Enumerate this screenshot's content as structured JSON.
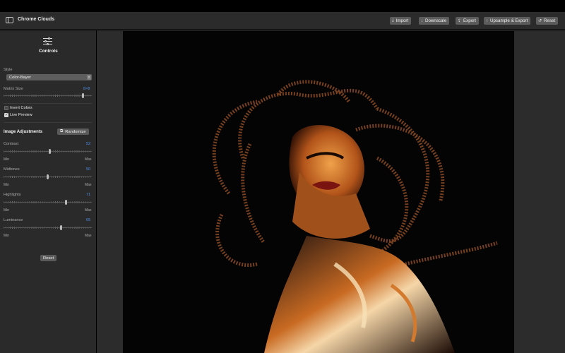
{
  "app": {
    "title": "Chrome Clouds"
  },
  "toolbar": {
    "import": "Import",
    "downscale": "Downscale",
    "export": "Export",
    "upsample_export": "Upsample & Export",
    "reset": "Reset"
  },
  "sidebar": {
    "heading": "Controls",
    "style_label": "Style",
    "style_value": "Color-Bayer",
    "matrix_label": "Matrix Size",
    "matrix_value": "8×8",
    "matrix_level": 0.9,
    "invert_label": "Invert Colors",
    "invert_checked": false,
    "live_label": "Live Preview",
    "live_checked": true,
    "adjustments_title": "Image Adjustments",
    "randomize_label": "Randomize",
    "contrast": {
      "label": "Contrast",
      "value": "52",
      "min": "Min",
      "max": "Max"
    },
    "midtones": {
      "label": "Midtones",
      "value": "50",
      "min": "Min",
      "max": "Max"
    },
    "highlights": {
      "label": "Highlights",
      "value": "71",
      "min": "Min",
      "max": "Max"
    },
    "luminance": {
      "label": "Luminance",
      "value": "65",
      "min": "Min",
      "max": "Max"
    },
    "reset_label": "Reset"
  },
  "icons": {
    "sidebar_toggle": "sidebar-icon",
    "controls": "sliders-icon",
    "import": "tray-arrow-down-icon",
    "downscale": "arrow-down-icon",
    "export": "share-icon",
    "upsample": "arrow-up-icon",
    "reset": "counterclockwise-arrow-icon",
    "randomize": "dice-icon"
  },
  "colors": {
    "accent": "#4d8fe6",
    "sidebar_bg": "#2a2a2a",
    "titlebar_bg": "#2b2b2b"
  }
}
